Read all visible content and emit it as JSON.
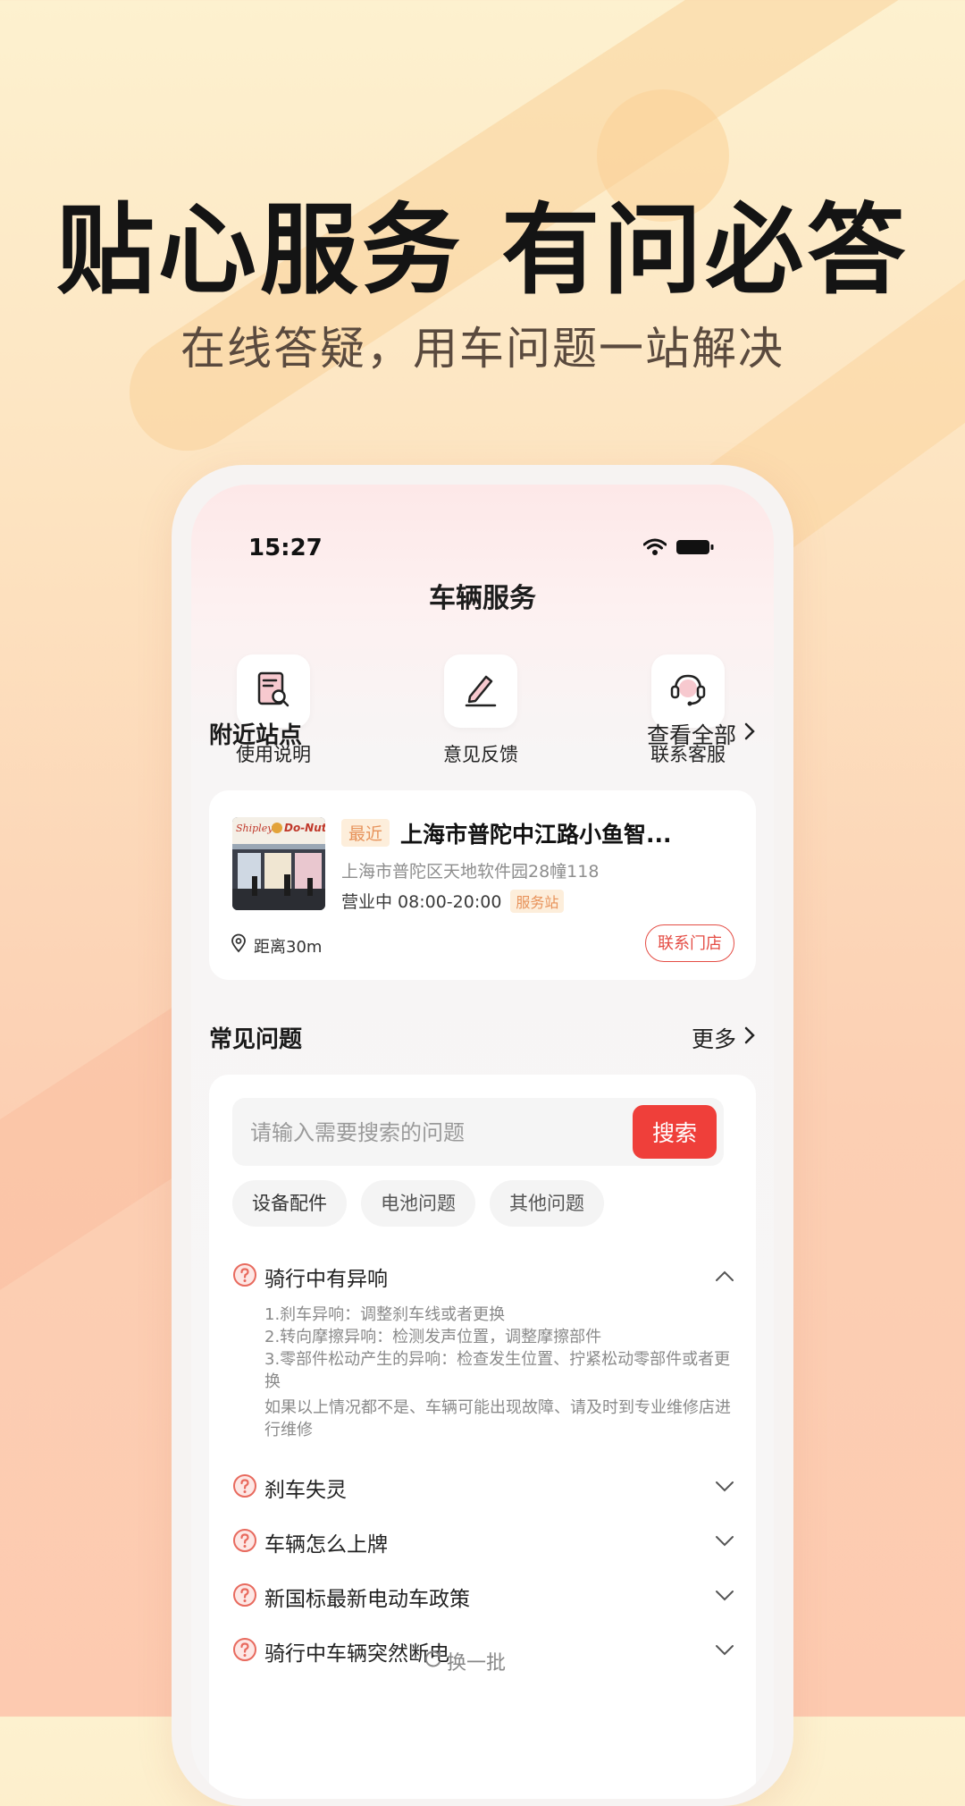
{
  "promo": {
    "headline": "贴心服务 有问必答",
    "subheadline": "在线答疑，用车问题一站解决"
  },
  "status_bar": {
    "time": "15:27"
  },
  "nav": {
    "title": "车辆服务"
  },
  "quick_actions": [
    {
      "label": "使用说明",
      "icon": "manual-search-icon"
    },
    {
      "label": "意见反馈",
      "icon": "edit-feedback-icon"
    },
    {
      "label": "联系客服",
      "icon": "headset-icon"
    }
  ],
  "nearby": {
    "title": "附近站点",
    "more_label": "查看全部",
    "station": {
      "tag": "最近",
      "name": "上海市普陀中江路小鱼智...",
      "address": "上海市普陀区天地软件园28幢118",
      "hours": "营业中 08:00-20:00",
      "type_tag": "服务站",
      "distance": "距离30m",
      "contact_label": "联系门店",
      "image_sign": "Shipley Do-Nuts"
    }
  },
  "faq": {
    "title": "常见问题",
    "more_label": "更多",
    "search_placeholder": "请输入需要搜索的问题",
    "search_button": "搜索",
    "chips": [
      "设备配件",
      "电池问题",
      "其他问题"
    ],
    "items": [
      {
        "question": "骑行中有异响",
        "expanded": true,
        "answer_lines": [
          "1.刹车异响：调整刹车线或者更换",
          "2.转向摩擦异响：检测发声位置，调整摩擦部件",
          "3.零部件松动产生的异响：检查发生位置、拧紧松动零部件或者更换",
          "如果以上情况都不是、车辆可能出现故障、请及时到专业维修店进行维修"
        ]
      },
      {
        "question": "刹车失灵",
        "expanded": false
      },
      {
        "question": "车辆怎么上牌",
        "expanded": false
      },
      {
        "question": "新国标最新电动车政策",
        "expanded": false
      },
      {
        "question": "骑行中车辆突然断电",
        "expanded": false
      }
    ],
    "refresh_label": "换一批"
  },
  "colors": {
    "accent_red": "#ef3f3a",
    "tag_orange": "#e7925a",
    "question_icon": "#e86a5e"
  }
}
